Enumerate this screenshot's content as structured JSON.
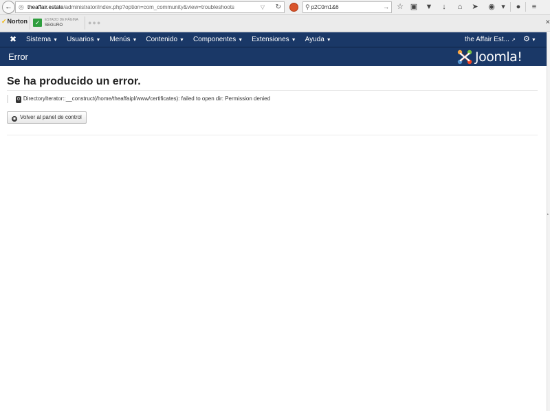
{
  "browser": {
    "url_host": "theaffair.estate",
    "url_path": "/administrator/index.php?option=com_community&view=troubleshoots",
    "search_value": "p2C0m1&6"
  },
  "norton": {
    "brand": "Norton",
    "safe_label": "ESTADO DE PÁGINA",
    "safe_status": "SEGURO"
  },
  "nav": {
    "menu": [
      "Sistema",
      "Usuarios",
      "Menús",
      "Contenido",
      "Componentes",
      "Extensiones",
      "Ayuda"
    ],
    "site_name": "the Affair Est..."
  },
  "header": {
    "title": "Error",
    "brand": "Joomla!"
  },
  "main": {
    "error_title": "Se ha producido un error.",
    "error_code": "0",
    "error_message": "DirectoryIterator::__construct(/home/theaffaipl/www/certificates): failed to open dir: Permission denied",
    "back_button": "Volver al panel de control"
  },
  "colors": {
    "nav_bg": "#1a3867",
    "joomla_red": "#e44d26"
  }
}
